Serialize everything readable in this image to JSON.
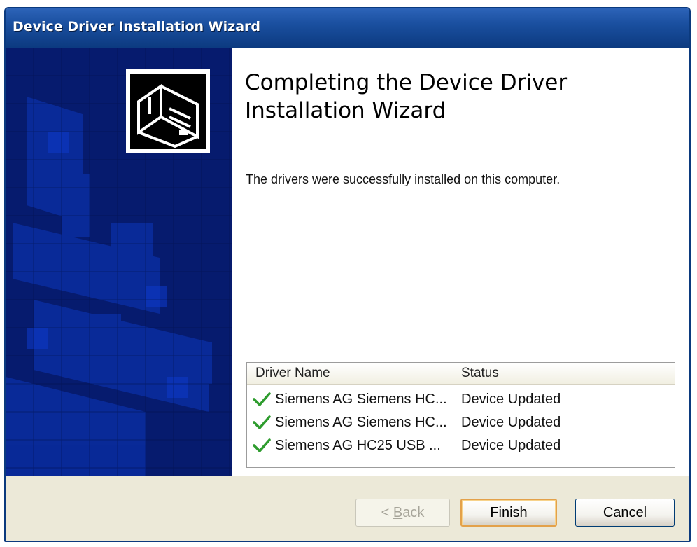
{
  "window": {
    "title": "Device Driver Installation Wizard"
  },
  "sidebar": {
    "icon": "hardware-install-icon"
  },
  "content": {
    "heading": "Completing the Device Driver Installation Wizard",
    "message": "The drivers were successfully installed on this computer."
  },
  "driver_list": {
    "columns": [
      "Driver Name",
      "Status"
    ],
    "rows": [
      {
        "icon": "checkmark-icon",
        "name": "Siemens AG Siemens HC...",
        "status": "Device Updated"
      },
      {
        "icon": "checkmark-icon",
        "name": "Siemens AG Siemens HC...",
        "status": "Device Updated"
      },
      {
        "icon": "checkmark-icon",
        "name": "Siemens AG HC25 USB ...",
        "status": "Device Updated"
      }
    ]
  },
  "buttons": {
    "back_prefix": "< ",
    "back_mnemonic": "B",
    "back_rest": "ack",
    "finish": "Finish",
    "cancel": "Cancel"
  },
  "colors": {
    "titlebar": "#1a4f9f",
    "sidebar": "#061b6e",
    "check": "#2e9c2e",
    "finish_focus": "#e3a14a"
  }
}
